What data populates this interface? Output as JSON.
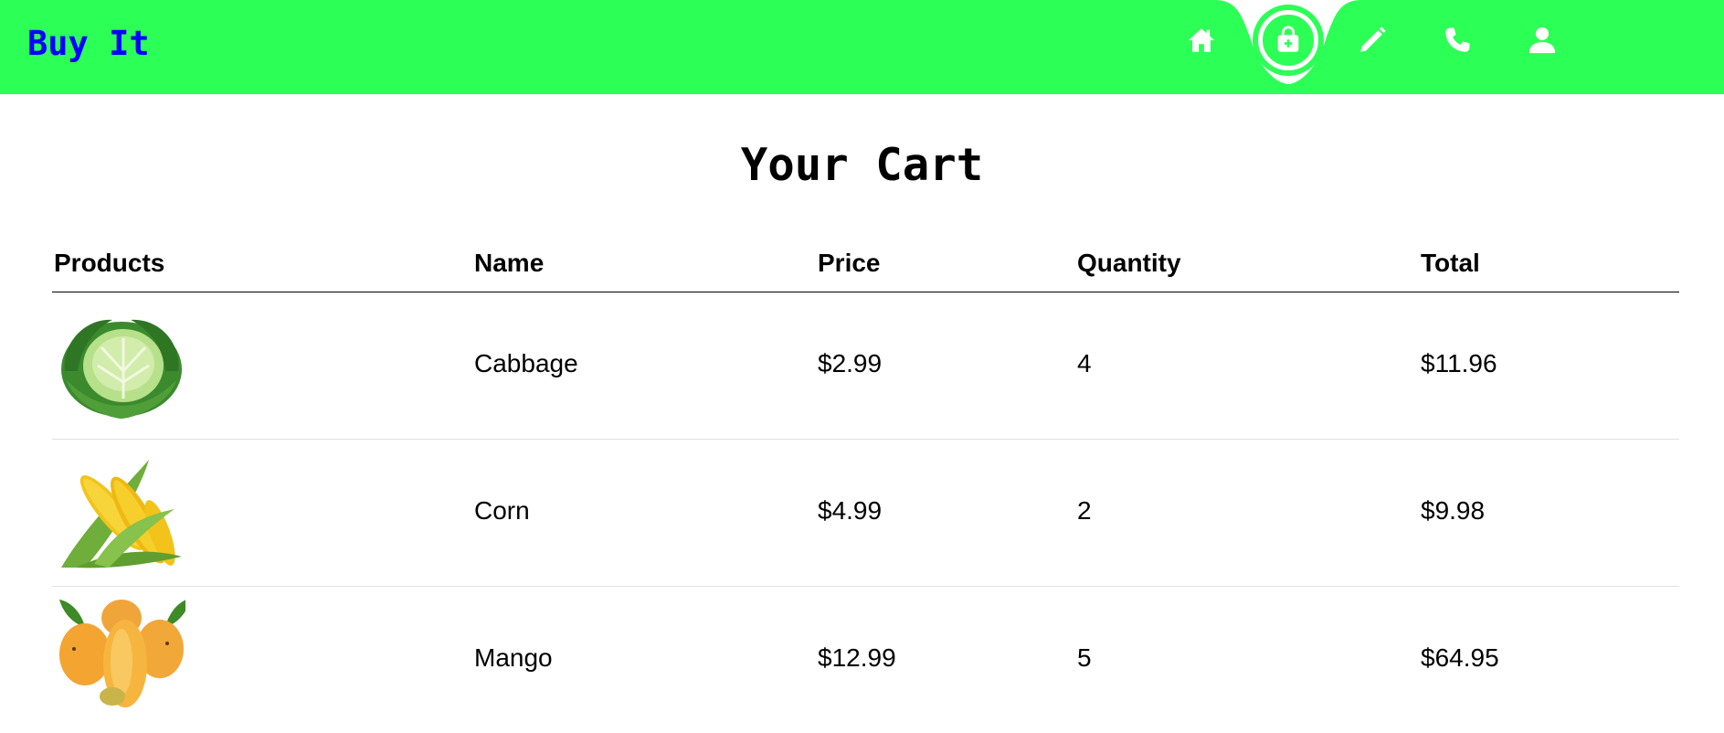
{
  "header": {
    "brand": "Buy It",
    "accent_color": "#2cff55",
    "brand_color": "#0a00ff",
    "nav_icons": [
      "home-icon",
      "shop-bag-icon",
      "edit-pencil-icon",
      "phone-icon",
      "user-icon"
    ],
    "active_nav": "shop-bag-icon"
  },
  "page": {
    "title": "Your Cart"
  },
  "table": {
    "columns": [
      "Products",
      "Name",
      "Price",
      "Quantity",
      "Total"
    ],
    "rows": [
      {
        "image": "cabbage-image",
        "name": "Cabbage",
        "price": "$2.99",
        "quantity": "4",
        "total": "$11.96"
      },
      {
        "image": "corn-image",
        "name": "Corn",
        "price": "$4.99",
        "quantity": "2",
        "total": "$9.98"
      },
      {
        "image": "mango-image",
        "name": "Mango",
        "price": "$12.99",
        "quantity": "5",
        "total": "$64.95"
      }
    ]
  }
}
